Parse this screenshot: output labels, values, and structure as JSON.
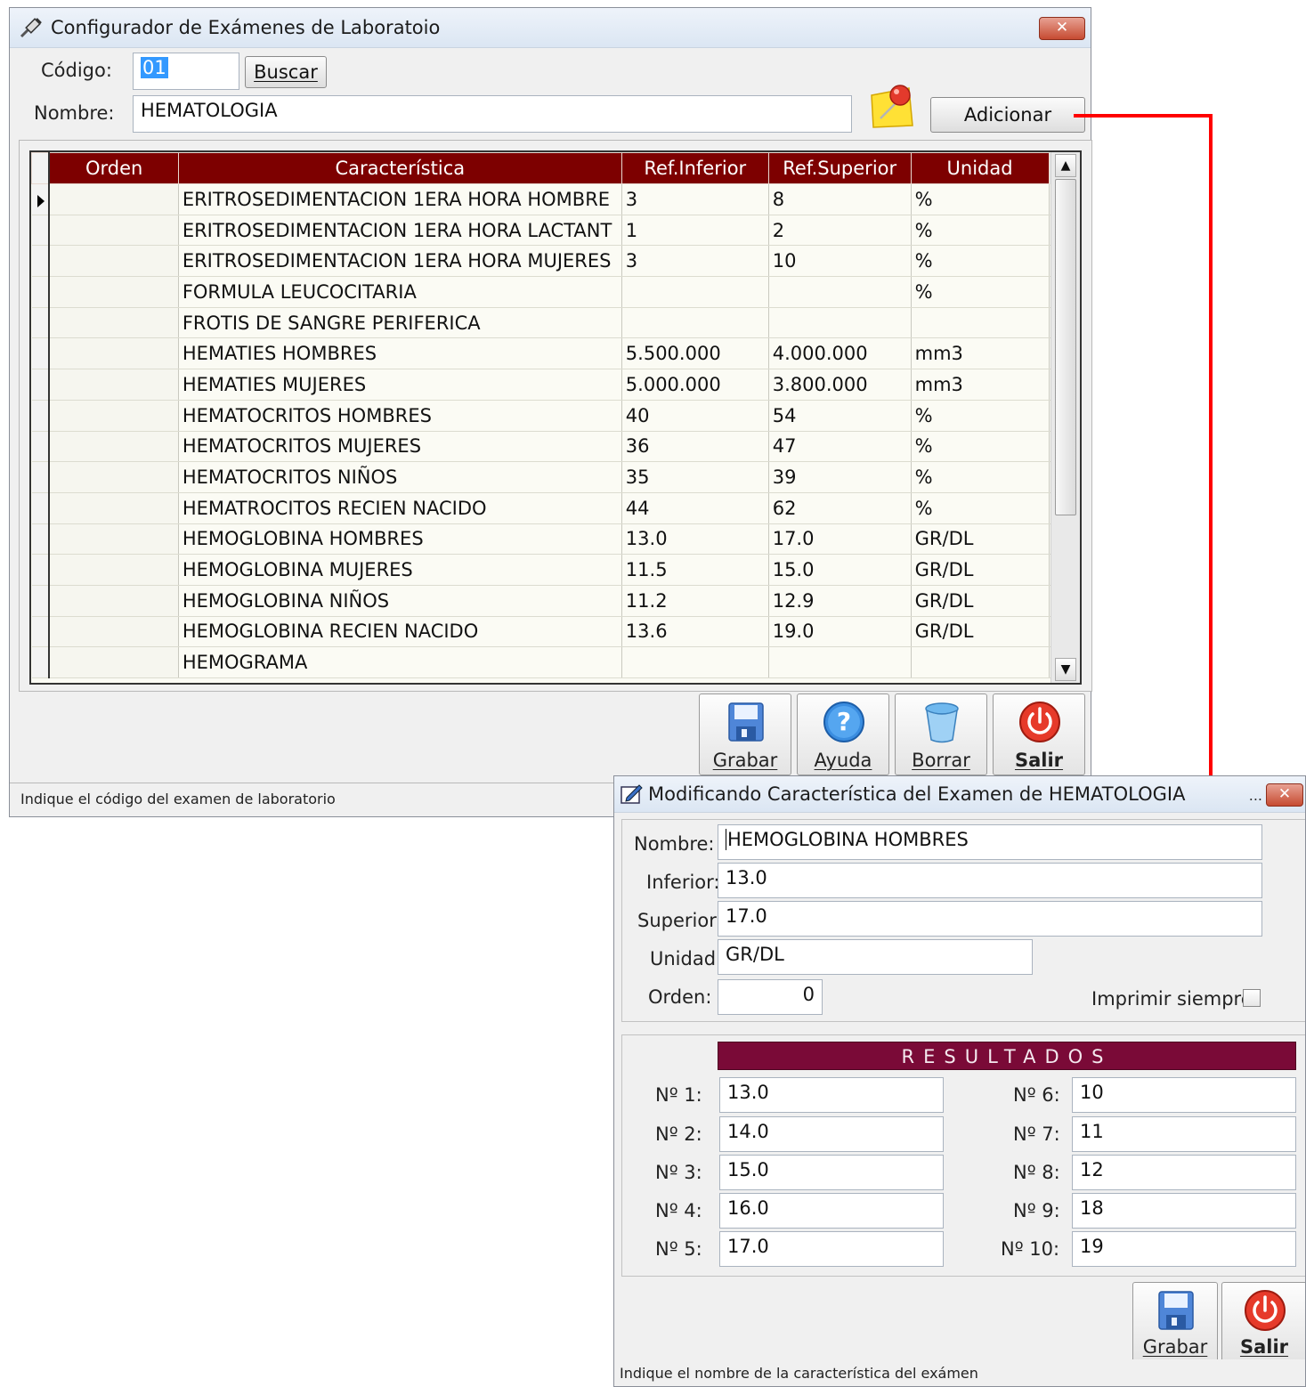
{
  "main": {
    "title": "Configurador de Exámenes de Laboratoio",
    "close": "✕",
    "codigo_label": "Código:",
    "codigo_value": "01",
    "buscar": "Buscar",
    "nombre_label": "Nombre:",
    "nombre_value": "HEMATOLOGIA",
    "adicionar": "Adicionar",
    "grid": {
      "headers": [
        "Orden",
        "Característica",
        "Ref.Inferior",
        "Ref.Superior",
        "Unidad"
      ],
      "rows": [
        {
          "orden": "",
          "caracteristica": "ERITROSEDIMENTACION 1ERA HORA HOMBRE",
          "inferior": "3",
          "superior": "8",
          "unidad": "%"
        },
        {
          "orden": "",
          "caracteristica": "ERITROSEDIMENTACION 1ERA HORA LACTANT",
          "inferior": "1",
          "superior": "2",
          "unidad": "%"
        },
        {
          "orden": "",
          "caracteristica": "ERITROSEDIMENTACION 1ERA HORA MUJERES",
          "inferior": "3",
          "superior": "10",
          "unidad": "%"
        },
        {
          "orden": "",
          "caracteristica": "FORMULA LEUCOCITARIA",
          "inferior": "",
          "superior": "",
          "unidad": "%"
        },
        {
          "orden": "",
          "caracteristica": "FROTIS DE SANGRE PERIFERICA",
          "inferior": "",
          "superior": "",
          "unidad": ""
        },
        {
          "orden": "",
          "caracteristica": "HEMATIES HOMBRES",
          "inferior": "5.500.000",
          "superior": "4.000.000",
          "unidad": "mm3"
        },
        {
          "orden": "",
          "caracteristica": "HEMATIES MUJERES",
          "inferior": "5.000.000",
          "superior": "3.800.000",
          "unidad": "mm3"
        },
        {
          "orden": "",
          "caracteristica": "HEMATOCRITOS HOMBRES",
          "inferior": "40",
          "superior": "54",
          "unidad": "%"
        },
        {
          "orden": "",
          "caracteristica": "HEMATOCRITOS MUJERES",
          "inferior": "36",
          "superior": "47",
          "unidad": "%"
        },
        {
          "orden": "",
          "caracteristica": "HEMATOCRITOS NIÑOS",
          "inferior": "35",
          "superior": "39",
          "unidad": "%"
        },
        {
          "orden": "",
          "caracteristica": "HEMATROCITOS RECIEN NACIDO",
          "inferior": "44",
          "superior": "62",
          "unidad": "%"
        },
        {
          "orden": "",
          "caracteristica": "HEMOGLOBINA HOMBRES",
          "inferior": "13.0",
          "superior": "17.0",
          "unidad": "GR/DL"
        },
        {
          "orden": "",
          "caracteristica": "HEMOGLOBINA MUJERES",
          "inferior": "11.5",
          "superior": "15.0",
          "unidad": "GR/DL"
        },
        {
          "orden": "",
          "caracteristica": "HEMOGLOBINA NIÑOS",
          "inferior": "11.2",
          "superior": "12.9",
          "unidad": "GR/DL"
        },
        {
          "orden": "",
          "caracteristica": "HEMOGLOBINA RECIEN NACIDO",
          "inferior": "13.6",
          "superior": "19.0",
          "unidad": "GR/DL"
        },
        {
          "orden": "",
          "caracteristica": "HEMOGRAMA",
          "inferior": "",
          "superior": "",
          "unidad": ""
        }
      ]
    },
    "buttons": {
      "grabar": "Grabar",
      "ayuda": "Ayuda",
      "borrar": "Borrar",
      "salir": "Salir"
    },
    "status": "Indique el código del examen de laboratorio"
  },
  "dialog": {
    "title": "Modificando Característica del Examen de HEMATOLOGIA",
    "dots": "...",
    "close": "✕",
    "nombre_label": "Nombre:",
    "nombre_value": "HEMOGLOBINA HOMBRES",
    "inferior_label": "Inferior:",
    "inferior_value": "13.0",
    "superior_label": "Superior:",
    "superior_value": "17.0",
    "unidad_label": "Unidad:",
    "unidad_value": "GR/DL",
    "orden_label": "Orden:",
    "orden_value": "0",
    "imprimir_label": "Imprimir siempre",
    "imprimir_checked": false,
    "resultados_title": "RESULTADOS",
    "resultados": [
      {
        "label": "Nº 1:",
        "value": "13.0"
      },
      {
        "label": "Nº 2:",
        "value": "14.0"
      },
      {
        "label": "Nº 3:",
        "value": "15.0"
      },
      {
        "label": "Nº 4:",
        "value": "16.0"
      },
      {
        "label": "Nº 5:",
        "value": "17.0"
      },
      {
        "label": "Nº 6:",
        "value": "10"
      },
      {
        "label": "Nº 7:",
        "value": "11"
      },
      {
        "label": "Nº 8:",
        "value": "12"
      },
      {
        "label": "Nº 9:",
        "value": "18"
      },
      {
        "label": "Nº 10:",
        "value": "19"
      }
    ],
    "buttons": {
      "grabar": "Grabar",
      "salir": "Salir"
    },
    "status": "Indique el nombre de la característica del exámen"
  },
  "colors": {
    "grid_header": "#7d0000",
    "resultados_bar": "#7a0a37",
    "connector_arrow": "#ff0000"
  }
}
